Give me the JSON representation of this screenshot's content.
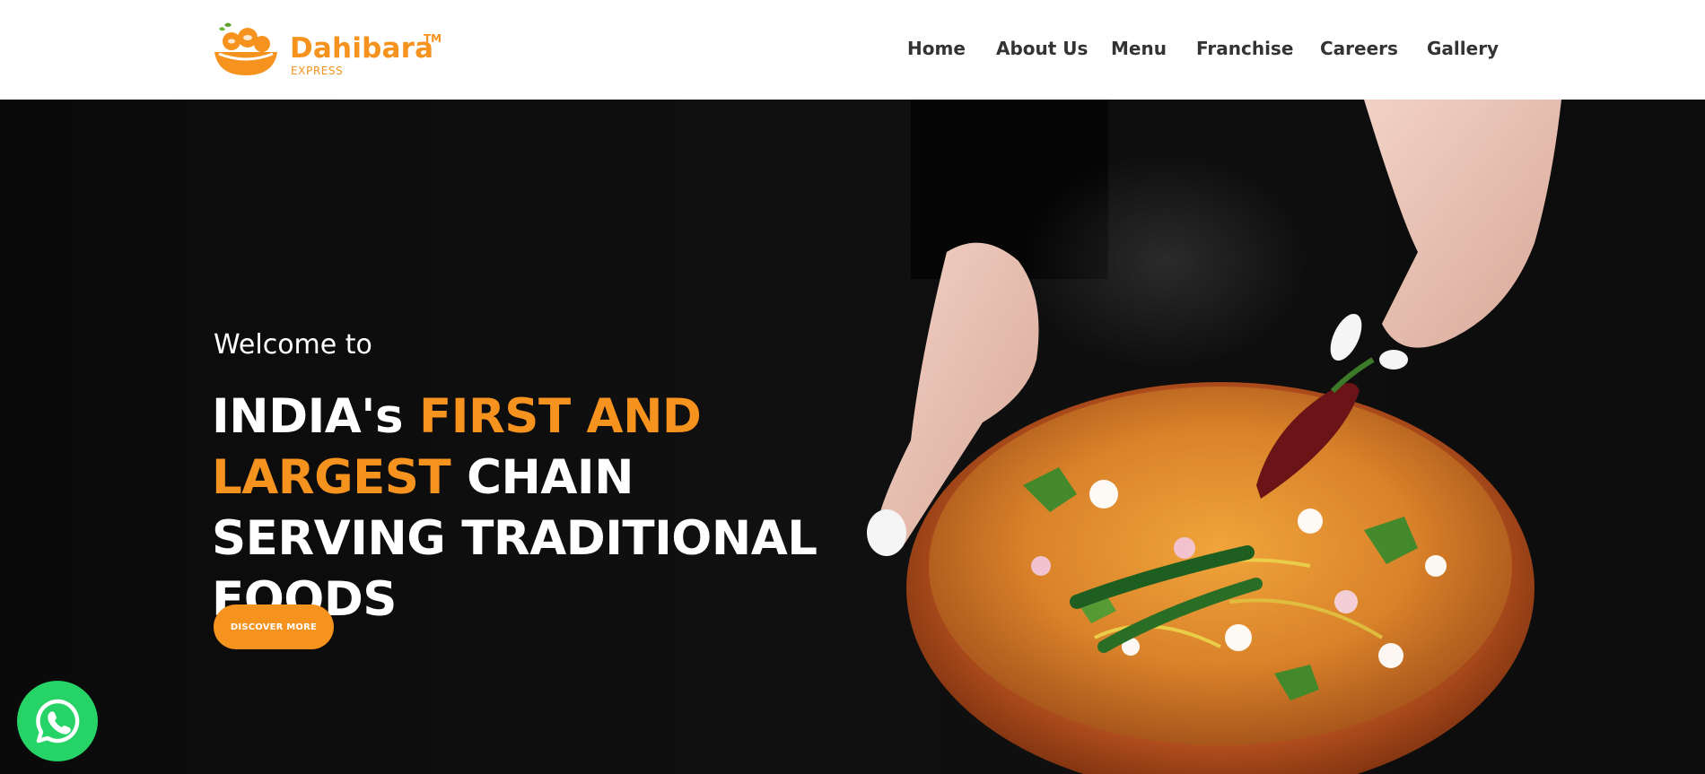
{
  "brand": {
    "name": "Dahibara",
    "trademark": "TM",
    "subtitle": "EXPRESS",
    "color": "#f6921e"
  },
  "nav": {
    "items": [
      {
        "label": "Home"
      },
      {
        "label": "About Us"
      },
      {
        "label": "Menu"
      },
      {
        "label": "Franchise"
      },
      {
        "label": "Careers"
      },
      {
        "label": "Gallery"
      }
    ]
  },
  "hero": {
    "welcome": "Welcome to",
    "headline": {
      "part1": "INDIA's ",
      "highlight": "FIRST AND LARGEST",
      "part2": " CHAIN SERVING TRADITIONAL FOODS"
    },
    "cta_label": "DISCOVER MORE",
    "accent_color": "#f6921e"
  },
  "floating": {
    "whatsapp_icon": "whatsapp-icon",
    "whatsapp_color": "#25d366"
  }
}
